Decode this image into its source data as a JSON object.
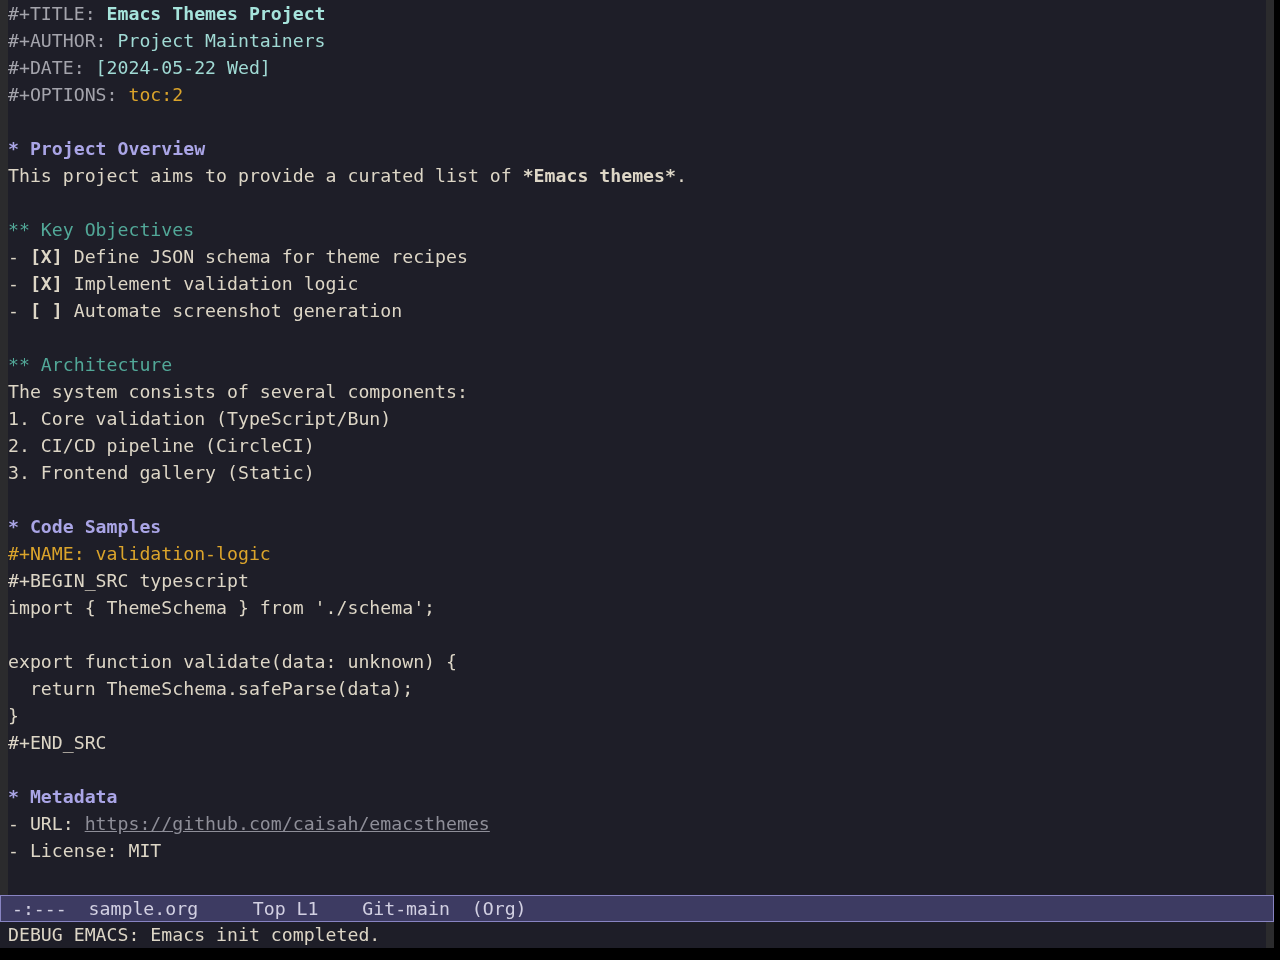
{
  "frame": {
    "buffer": {
      "keywords": [
        {
          "kind": "title",
          "key": "#+TITLE:",
          "value": "Emacs Themes Project"
        },
        {
          "kind": "meta",
          "key": "#+AUTHOR:",
          "value": "Project Maintainers"
        },
        {
          "kind": "meta",
          "key": "#+DATE:",
          "value": "[2024-05-22 Wed]"
        },
        {
          "kind": "option",
          "key": "#+OPTIONS:",
          "value": "toc:2"
        }
      ],
      "sections": [
        {
          "marker": "*",
          "title": "Project Overview",
          "blocks": [
            {
              "kind": "paragraph",
              "text": "This project aims to provide a curated list of",
              "emphasis": "*Emacs themes*",
              "tail": "."
            }
          ],
          "children": [
            {
              "marker": "**",
              "title": "Key Objectives",
              "blocks": [
                {
                  "kind": "checklist",
                  "items": [
                    {
                      "bullet": "-",
                      "box": "[X]",
                      "text": "Define JSON schema for theme recipes"
                    },
                    {
                      "bullet": "-",
                      "box": "[X]",
                      "text": "Implement validation logic"
                    },
                    {
                      "bullet": "-",
                      "box": "[ ]",
                      "text": "Automate screenshot generation"
                    }
                  ]
                }
              ]
            },
            {
              "marker": "**",
              "title": "Architecture",
              "blocks": [
                {
                  "kind": "paragraph",
                  "text": "The system consists of several components:"
                },
                {
                  "kind": "numbered",
                  "items": [
                    {
                      "number": "1.",
                      "text": "Core validation (TypeScript/Bun)"
                    },
                    {
                      "number": "2.",
                      "text": "CI/CD pipeline (CircleCI)"
                    },
                    {
                      "number": "3.",
                      "text": "Frontend gallery (Static)"
                    }
                  ]
                }
              ]
            }
          ]
        },
        {
          "marker": "*",
          "title": "Code Samples",
          "blocks": [
            {
              "kind": "keyword",
              "key": "#+NAME:",
              "value": "validation-logic"
            },
            {
              "kind": "source",
              "begin": "#+BEGIN_SRC",
              "language": "typescript",
              "code": "import { ThemeSchema } from './schema';\n\nexport function validate(data: unknown) {\n  return ThemeSchema.safeParse(data);\n}",
              "end": "#+END_SRC"
            }
          ]
        },
        {
          "marker": "*",
          "title": "Metadata",
          "blocks": [
            {
              "kind": "list",
              "items": [
                {
                  "kind": "link",
                  "bullet": "-",
                  "label": "URL:",
                  "value": "https://github.com/caisah/emacsthemes"
                },
                {
                  "kind": "text",
                  "bullet": "-",
                  "label": "License:",
                  "value": "MIT"
                }
              ]
            }
          ]
        }
      ]
    },
    "mode_line": {
      "status": "-:---",
      "buffer_name": "sample.org",
      "position": "Top L1",
      "vc": "Git-main",
      "mode": "(Org)"
    },
    "echo_area": {
      "message": "DEBUG EMACS: Emacs init completed."
    }
  }
}
